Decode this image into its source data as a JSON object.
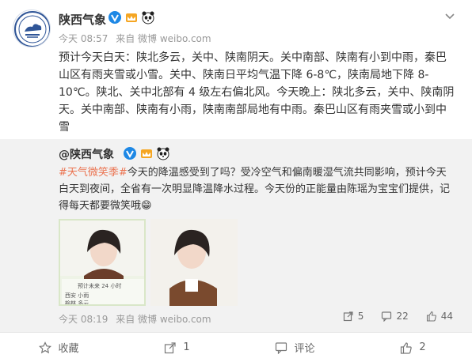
{
  "post": {
    "author": "陕西气象",
    "time": "今天 08:57",
    "source": "来自 微博 weibo.com",
    "text": "预计今天白天：陕北多云，关中、陕南阴天。关中南部、陕南有小到中雨，秦巴山区有雨夹雪或小雪。关中、陕南日平均气温下降 6-8℃，陕南局地下降 8-10℃。陕北、关中北部有 4 级左右偏北风。今天晚上：陕北多云，关中、陕南阴天。关中南部、陕南有小雨，陕南南部局地有中雨。秦巴山区有雨夹雪或小到中雪",
    "avatar_text": "陕西省气象局"
  },
  "repost": {
    "author": "@陕西气象",
    "hashtag": "#天气微笑季#",
    "text": "今天的降温感受到了吗？受冷空气和偏南暖湿气流共同影响，预计今天白天到夜间，全省有一次明显降温降水过程。今天份的正能量由陈瑶为宝宝们提供，记得每天都要微笑哦",
    "emoji": "😁",
    "time": "今天 08:19",
    "source": "来自 微博 weibo.com",
    "reposts": "5",
    "comments": "22",
    "likes": "44",
    "photo1_caption": "西安 小雨",
    "photo1_title": "预计未来 24 小时",
    "photo1_city2": "榆林 多云"
  },
  "toolbar": {
    "favorite": "收藏",
    "repost": "1",
    "comment": "评论",
    "like": "2"
  },
  "colors": {
    "accent": "#eb7350",
    "link": "#eb7350",
    "text": "#333333",
    "muted": "#999999",
    "repost_bg": "#f2f2f2"
  }
}
